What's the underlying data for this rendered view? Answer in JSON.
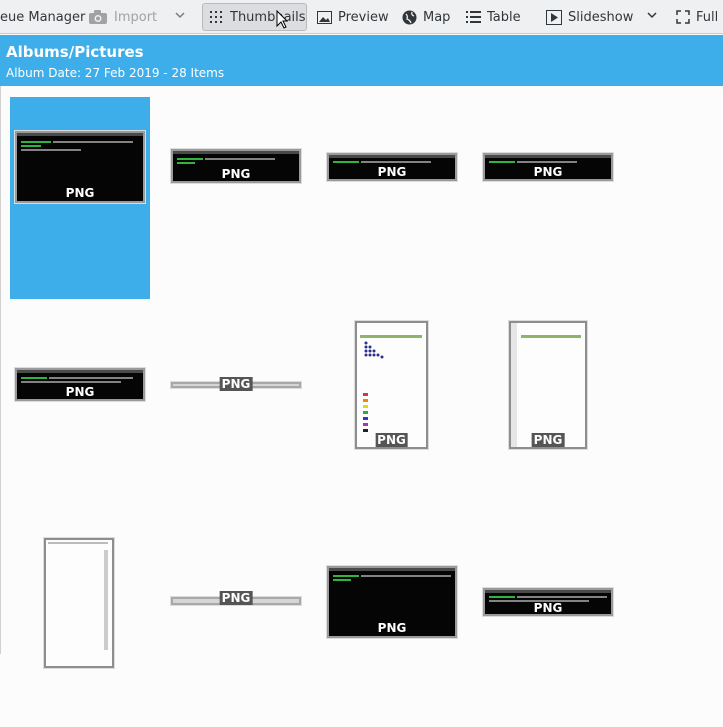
{
  "toolbar": {
    "queue_manager": "eue Manager",
    "import": "Import",
    "thumbnails": "Thumbnails",
    "preview": "Preview",
    "map": "Map",
    "table": "Table",
    "slideshow": "Slideshow",
    "full_screen": "Full S"
  },
  "album": {
    "title": "Albums/Pictures",
    "subtitle": "Album Date: 27 Feb 2019 - 28 Items"
  },
  "thumbnails": [
    {
      "format": "PNG",
      "selected": true
    },
    {
      "format": "PNG",
      "selected": false
    },
    {
      "format": "PNG",
      "selected": false
    },
    {
      "format": "PNG",
      "selected": false
    },
    {
      "format": "PNG",
      "selected": false
    },
    {
      "format": "PNG",
      "selected": false
    },
    {
      "format": "PNG",
      "selected": false
    },
    {
      "format": "PNG",
      "selected": false
    },
    {
      "format": "PNG",
      "selected": false
    },
    {
      "format": "PNG",
      "selected": false
    },
    {
      "format": "PNG",
      "selected": false
    },
    {
      "format": "PNG",
      "selected": false
    }
  ],
  "colors": {
    "selection": "#3daee9",
    "toolbar_bg": "#eff0f1",
    "terminal_bg": "#050505",
    "terminal_text": "#3ad24a"
  }
}
